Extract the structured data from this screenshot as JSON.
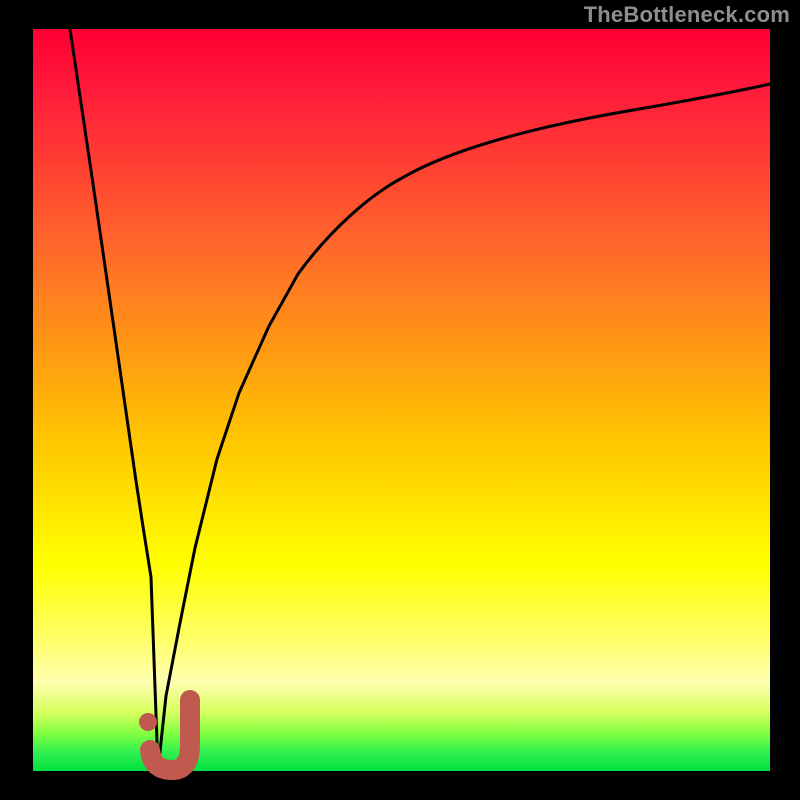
{
  "watermark": {
    "text": "TheBottleneck.com"
  },
  "colors": {
    "black": "#000000",
    "red": "#ff0033",
    "yellow": "#ffff00",
    "green_mid": "#80ff00",
    "green": "#00e040",
    "marker": "#c05a4e",
    "curve": "#000000"
  },
  "chart_data": {
    "type": "line",
    "title": "",
    "xlabel": "",
    "ylabel": "",
    "xlim": [
      0,
      100
    ],
    "ylim": [
      0,
      100
    ],
    "grid": false,
    "notes": "Bottleneck-style curve. V shape descends steeply from top-left to a minimum near x≈17, then rises as a saturating curve toward the top-right. Background is a vertical thermal gradient from red (top) through yellow to green (bottom). Thin black border. A short rounded J-shaped marker highlights the minimum region.",
    "series": [
      {
        "name": "bottleneck-curve",
        "x": [
          5,
          8,
          10,
          12,
          14,
          15,
          16,
          17,
          18,
          20,
          22,
          25,
          28,
          32,
          36,
          42,
          50,
          60,
          70,
          80,
          90,
          100
        ],
        "values": [
          100,
          80,
          66,
          53,
          39,
          32,
          26,
          0,
          10,
          20,
          30,
          42,
          51,
          60,
          67,
          74,
          80,
          85,
          88,
          90,
          91.5,
          92.5
        ]
      }
    ],
    "marker": {
      "description": "J-shaped highlight near the curve minimum (no numeric label visible).",
      "approx_x_range": [
        16,
        22
      ],
      "approx_y_range": [
        0,
        10
      ]
    }
  }
}
